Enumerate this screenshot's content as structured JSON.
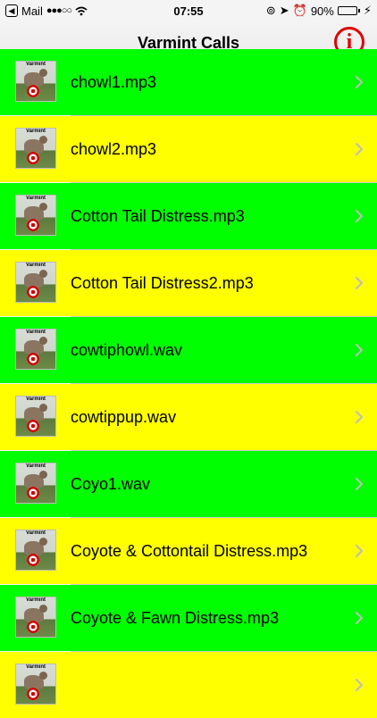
{
  "status": {
    "back_app": "Mail",
    "time": "07:55",
    "battery": "90%",
    "battery_level": 0.9
  },
  "nav": {
    "title": "Varmint Calls",
    "info_glyph": "i"
  },
  "colors": {
    "green_row": "#00ff00",
    "yellow_row": "#ffff00",
    "info_red": "#e00000"
  },
  "list": {
    "thumb_label": "Varmint",
    "items": [
      {
        "label": "chowl1.mp3",
        "color": "green"
      },
      {
        "label": "chowl2.mp3",
        "color": "yellow"
      },
      {
        "label": "Cotton Tail Distress.mp3",
        "color": "green"
      },
      {
        "label": "Cotton Tail Distress2.mp3",
        "color": "yellow"
      },
      {
        "label": "cowtiphowl.wav",
        "color": "green"
      },
      {
        "label": "cowtippup.wav",
        "color": "yellow"
      },
      {
        "label": "Coyo1.wav",
        "color": "green"
      },
      {
        "label": "Coyote & Cottontail Distress.mp3",
        "color": "yellow"
      },
      {
        "label": "Coyote & Fawn Distress.mp3",
        "color": "green"
      },
      {
        "label": "",
        "color": "yellow"
      }
    ]
  }
}
